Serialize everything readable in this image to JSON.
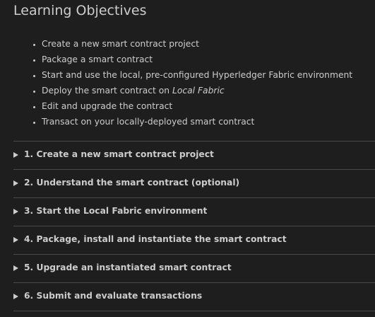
{
  "title": "Learning Objectives",
  "objectives": [
    {
      "text": "Create a new smart contract project"
    },
    {
      "text": "Package a smart contract"
    },
    {
      "text": "Start and use the local, pre-configured Hyperledger Fabric environment"
    },
    {
      "text": "Deploy the smart contract on ",
      "emphasis": "Local Fabric"
    },
    {
      "text": "Edit and upgrade the contract"
    },
    {
      "text": "Transact on your locally-deployed smart contract"
    }
  ],
  "sections": [
    {
      "label": "1. Create a new smart contract project",
      "expanded": false
    },
    {
      "label": "2. Understand the smart contract (optional)",
      "expanded": false
    },
    {
      "label": "3. Start the Local Fabric environment",
      "expanded": false
    },
    {
      "label": "4. Package, install and instantiate the smart contract",
      "expanded": false
    },
    {
      "label": "5. Upgrade an instantiated smart contract",
      "expanded": false
    },
    {
      "label": "6. Submit and evaluate transactions",
      "expanded": false
    }
  ],
  "icons": {
    "section_toggle": "caret-right-icon"
  }
}
